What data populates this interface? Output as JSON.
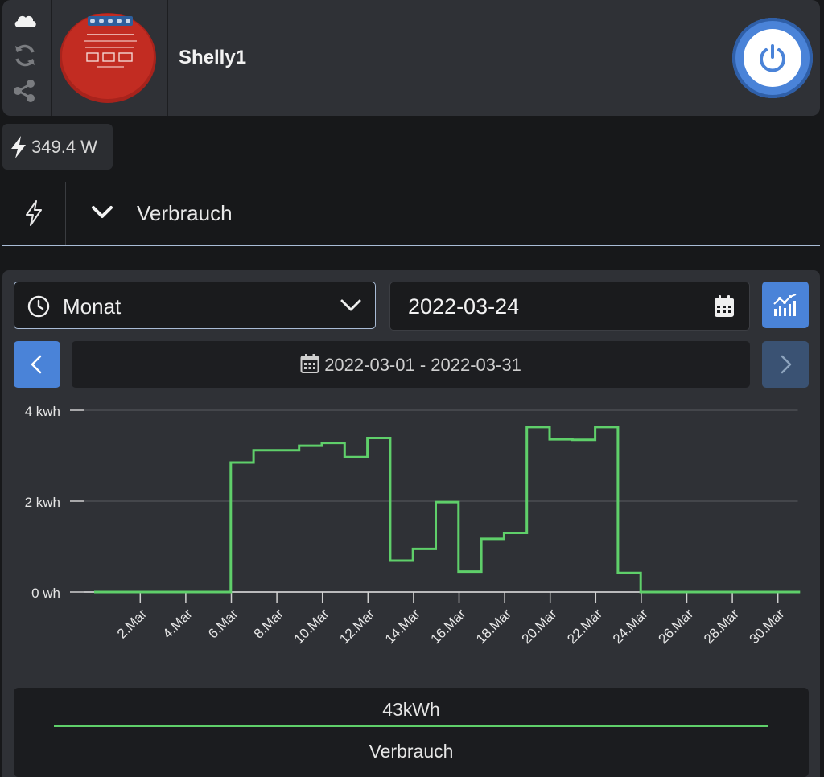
{
  "device": {
    "name": "Shelly1",
    "image_label": "Shelly 1PM",
    "icons": [
      "cloud-icon",
      "refresh-icon",
      "share-icon",
      "power-icon"
    ]
  },
  "power_badge": {
    "value": "349.4 W",
    "icon": "bolt-icon"
  },
  "section": {
    "title": "Verbrauch",
    "icon": "bolt-outline-icon",
    "toggle_icon": "chevron-down-icon"
  },
  "controls": {
    "period": "Monat",
    "date": "2022-03-24",
    "range": "2022-03-01 - 2022-03-31"
  },
  "colors": {
    "accent": "#4a83d8",
    "series": "#5fcf6a",
    "card": "#2f3136",
    "background": "#17181a"
  },
  "chart_data": {
    "type": "line",
    "step": true,
    "title": "",
    "xlabel": "",
    "ylabel": "",
    "x": [
      1,
      2,
      3,
      4,
      5,
      6,
      7,
      8,
      9,
      10,
      11,
      12,
      13,
      14,
      15,
      16,
      17,
      18,
      19,
      20,
      21,
      22,
      23,
      24,
      25,
      26,
      27,
      28,
      29,
      30,
      31
    ],
    "y_kwh": [
      0,
      0,
      0,
      0,
      0,
      0,
      2.85,
      3.12,
      3.12,
      3.22,
      3.28,
      2.97,
      3.39,
      0.69,
      0.95,
      1.98,
      0.45,
      1.17,
      1.3,
      3.63,
      3.36,
      3.35,
      3.63,
      0.42,
      0,
      0,
      0,
      0,
      0,
      0,
      0
    ],
    "ylim": [
      0,
      4
    ],
    "y_ticks": [
      "0 wh",
      "2 kwh",
      "4 kwh"
    ],
    "x_ticks": [
      "2.Mar",
      "4.Mar",
      "6.Mar",
      "8.Mar",
      "10.Mar",
      "12.Mar",
      "14.Mar",
      "16.Mar",
      "18.Mar",
      "20.Mar",
      "22.Mar",
      "24.Mar",
      "26.Mar",
      "28.Mar",
      "30.Mar"
    ],
    "grid": true,
    "series": [
      {
        "name": "Verbrauch",
        "total": "43kWh"
      }
    ]
  }
}
